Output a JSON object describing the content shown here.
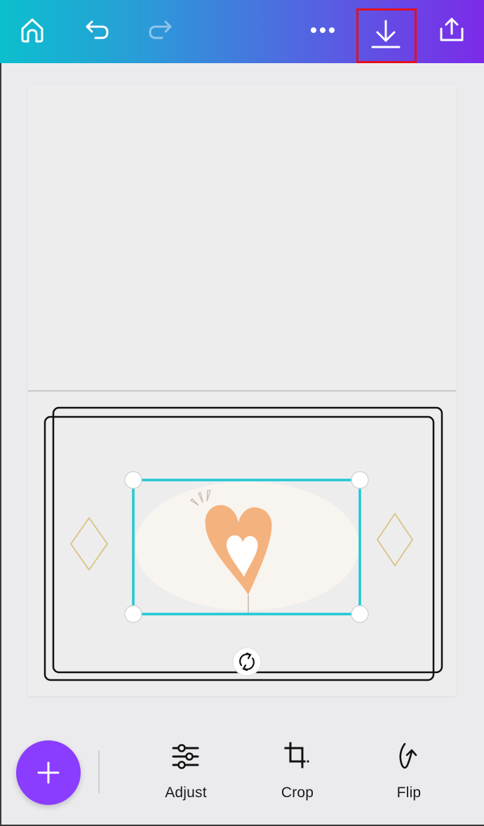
{
  "topbar": {
    "buttons": [
      {
        "id": "home",
        "icon": "home-icon",
        "enabled": true
      },
      {
        "id": "undo",
        "icon": "undo-icon",
        "enabled": true
      },
      {
        "id": "redo",
        "icon": "redo-icon",
        "enabled": false
      },
      {
        "id": "more",
        "icon": "more-horizontal-icon",
        "enabled": true
      },
      {
        "id": "download",
        "icon": "download-icon",
        "enabled": true,
        "highlighted": true
      },
      {
        "id": "share",
        "icon": "share-upload-icon",
        "enabled": true
      }
    ],
    "gradient": [
      "#0cbfcd",
      "#7c2ae8"
    ],
    "highlight_color": "#e3101f"
  },
  "canvas": {
    "pages": 2,
    "selected_element": "heart-image",
    "selection_color": "#1ec8d4",
    "heart_color": "#f4b27e",
    "ellipse_color": "#f8f4ef",
    "diamond_color": "#d9be7a"
  },
  "bottombar": {
    "add_button": {
      "icon": "plus-icon",
      "color": "#8b3dff"
    },
    "tools": [
      {
        "label": "Adjust",
        "icon": "sliders-icon"
      },
      {
        "label": "Crop",
        "icon": "crop-icon"
      },
      {
        "label": "Flip",
        "icon": "flip-icon"
      }
    ]
  }
}
